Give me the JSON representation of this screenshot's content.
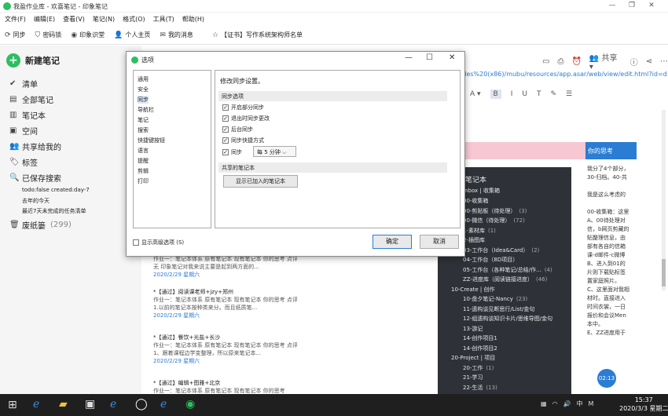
{
  "app": {
    "title": "我盈作业库 - 欢喜笔记 - 印象笔记",
    "colors": {
      "accent": "#2dbe60",
      "link": "#2b7cd3"
    }
  },
  "menu": [
    "文件(F)",
    "编辑(E)",
    "查看(V)",
    "笔记(N)",
    "格式(O)",
    "工具(T)",
    "帮助(H)"
  ],
  "toolbar": {
    "sync": "同步",
    "activity": "密码锁",
    "yinxiang": "印象识堂",
    "profile": "个人主页",
    "messages": "我的消息",
    "ad": "【证书】写作系统架构师名单"
  },
  "sidebar": {
    "new_note": "新建笔记",
    "items": [
      "清单",
      "全部笔记",
      "笔记本",
      "空间",
      "共享给我的",
      "标签",
      "已保存搜索"
    ],
    "saved": [
      "todo:false created:day-7",
      "去年的今天",
      "最近7天未完成的任务清单"
    ],
    "trash": "废纸篓",
    "trash_count": "(299)"
  },
  "notes": [
    {
      "title": "",
      "desc": "作业一：笔记本体系 原有笔记本 现有笔记本 你的思考 点评 无 印象笔记对我来说主要是起到两方面的...",
      "date": "2020/2/29 星期六"
    },
    {
      "title": "*【通过】阅读课老师+jzy+郑州",
      "desc": "作业一：笔记本体系 原有笔记本 现有笔记本 你的思考 点评 1.以前的笔记本按种类来分。而且纸质笔...",
      "date": "2020/2/29 星期六"
    },
    {
      "title": "*【通过】餐饮+光盐+长沙",
      "desc": "作业一：笔记本体系 原有笔记本 现有笔记本 你的思考 点评 1、跟着课程边学变整理，所以原来笔记本...",
      "date": "2020/2/29 星期六"
    },
    {
      "title": "*【通过】编辑+图雅+北京",
      "desc": "作业一：笔记本体系 原有笔记本 现有笔记本 你的思考",
      "date": ""
    }
  ],
  "note": {
    "share": "共享",
    "path": "Files%20(x86)/mubu/resources/app.asar/web/view/edit.html?id=d",
    "thinking": "你的思考",
    "zoom": "02:13"
  },
  "tree": [
    {
      "name": "00-收集箱",
      "count": ""
    },
    {
      "name": "00-剪贴板（待处理）",
      "count": "(3)"
    },
    {
      "name": "00-微信（待处理）",
      "count": "(72)"
    },
    {
      "name": "1-素材库",
      "count": "(1)"
    },
    {
      "name": "2-插图库",
      "count": ""
    },
    {
      "name": "03-工作台（Idea&Card）",
      "count": "(2)"
    },
    {
      "name": "04-工作台（8D项目）",
      "count": ""
    },
    {
      "name": "05-工作台（各种笔记/总结/作...",
      "count": "(4)"
    },
    {
      "name": "ZZ-进度库（阅读链接进度）",
      "count": "(46)"
    },
    {
      "name": "10-Create | 创作",
      "count": ""
    },
    {
      "name": "10-盘夕笔记-Nancy",
      "count": "(23)"
    },
    {
      "name": "11-遗构谈见断思行/List/金句",
      "count": ""
    },
    {
      "name": "12-组遗构谈知识卡片/思维导图/金句",
      "count": ""
    },
    {
      "name": "13-游记",
      "count": ""
    },
    {
      "name": "14-创作项目1",
      "count": ""
    },
    {
      "name": "14-创作项目2",
      "count": ""
    },
    {
      "name": "20-Project | 项目",
      "count": ""
    },
    {
      "name": "20-工作",
      "count": "(1)"
    },
    {
      "name": "21-学习",
      "count": ""
    },
    {
      "name": "22-生活",
      "count": "(13)"
    }
  ],
  "tree_header": "笔记本",
  "tree_inbox": "Inbox | 收集箱",
  "right_text": [
    "我分了4个部分，",
    "30-归档。40-共",
    "",
    "我是这么考虑的",
    "",
    "00-收集箱：这里",
    "A、00待处理对",
    "信，b网页剪藏的",
    "贴整理信息，由",
    "部有各自的信箱",
    "课-d邮件-c微博",
    "B、进入到01的",
    "片则下载贴标签",
    "置家庭照片。",
    "C、这里面对我相",
    "材时。直接进入",
    "时间衣裳，一日",
    "报价和会议Men",
    "本中。",
    "E、ZZ进度用于"
  ],
  "dialog": {
    "title": "选项",
    "tree": [
      "通用",
      "安全",
      "同步",
      "导航栏",
      "笔记",
      "搜索",
      "快捷键按钮",
      "语言",
      "提醒",
      "剪辑",
      "打印"
    ],
    "hint": "修改同步设置。",
    "sec_sync": "同步选项",
    "checks": [
      "开启部分同步",
      "退出时同步更改",
      "后台同步",
      "同步快捷方式",
      "同步"
    ],
    "freq": "每 5 分钟",
    "sec_shared": "共享的笔记本",
    "show_btn": "显示已加入的笔记本",
    "advanced": "显示高级选项 (S)",
    "ok": "确定",
    "cancel": "取消"
  },
  "taskbar": {
    "time": "15:37",
    "date": "2020/3/3 星期二",
    "ime": "中",
    "ime2": "M"
  }
}
